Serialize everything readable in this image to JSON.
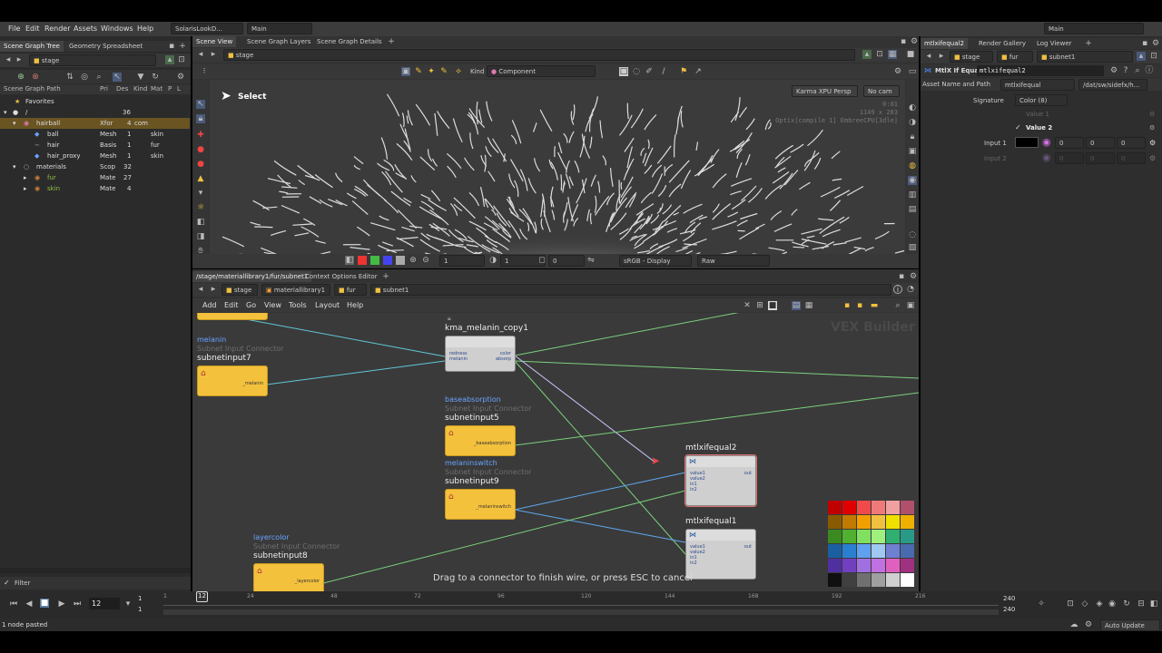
{
  "menubar": {
    "items": [
      "File",
      "Edit",
      "Render",
      "Assets",
      "Windows",
      "Help"
    ],
    "desktop": "SolarisLookD...",
    "desktop_right": "Main",
    "main_right": "Main"
  },
  "left": {
    "tabs": [
      "Scene Graph Tree",
      "Geometry Spreadsheet"
    ],
    "path": "stage",
    "columns": [
      "Scene Graph Path",
      "Pri",
      "Des",
      "Kind",
      "Mat",
      "P",
      "L"
    ],
    "rows": [
      {
        "name": "Favorites",
        "pri": "",
        "des": "",
        "kind": "",
        "mat": ""
      },
      {
        "name": "/",
        "pri": "",
        "des": "36",
        "kind": "",
        "mat": ""
      },
      {
        "name": "hairball",
        "pri": "Xfor",
        "des": "4",
        "kind": "com",
        "mat": ""
      },
      {
        "name": "ball",
        "pri": "Mesh",
        "des": "1",
        "kind": "",
        "mat": "skin"
      },
      {
        "name": "hair",
        "pri": "Basis",
        "des": "1",
        "kind": "",
        "mat": "fur"
      },
      {
        "name": "hair_proxy",
        "pri": "Mesh",
        "des": "1",
        "kind": "",
        "mat": "skin"
      },
      {
        "name": "materials",
        "pri": "Scop",
        "des": "32",
        "kind": "",
        "mat": ""
      },
      {
        "name": "fur",
        "pri": "Mate",
        "des": "27",
        "kind": "",
        "mat": ""
      },
      {
        "name": "skin",
        "pri": "Mate",
        "des": "4",
        "kind": "",
        "mat": ""
      }
    ],
    "filter": "Filter"
  },
  "viewer": {
    "tabs": [
      "Scene View",
      "Scene Graph Layers",
      "Scene Graph Details"
    ],
    "path": "stage",
    "kind_label": "Kind",
    "kind_value": "Component",
    "select": "Select",
    "renderer": "Karma XPU Persp",
    "cam": "No cam",
    "info": [
      "0:01",
      "1149 x 283",
      "Optix[compile 1] EmbreeCPU[3dle]"
    ],
    "bottom": {
      "val1": "1",
      "val2": "1",
      "val3": "0",
      "display": "sRGB - Display",
      "raw": "Raw"
    }
  },
  "network": {
    "tabs": [
      "/stage/materiallibrary1/fur/subnet1",
      "Context Options Editor"
    ],
    "crumbs": [
      "stage",
      "materiallibrary1",
      "fur",
      "subnet1"
    ],
    "menu": [
      "Add",
      "Edit",
      "Go",
      "View",
      "Tools",
      "Layout",
      "Help"
    ],
    "watermark": "VEX Builder",
    "hint": "Drag to a connector to finish wire, or press ESC to cancel",
    "nodes": {
      "melanin": {
        "title": "melanin",
        "sub": "Subnet Input Connector",
        "name": "subnetinput7",
        "port": "_melanin"
      },
      "kma": {
        "name": "kma_melanin_copy1",
        "in1": "redness",
        "in2": "melanin",
        "out1": "color",
        "out2": "absorp"
      },
      "base": {
        "title": "baseabsorption",
        "sub": "Subnet Input Connector",
        "name": "subnetinput5",
        "port": "_baseabsorption"
      },
      "mswitch": {
        "title": "melaninswitch",
        "sub": "Subnet Input Connector",
        "name": "subnetinput9",
        "port": "_melaninswitch"
      },
      "layer": {
        "title": "layercolor",
        "sub": "Subnet Input Connector",
        "name": "subnetinput8",
        "port": "_layercolor"
      },
      "if2": {
        "name": "mtlxifequal2",
        "ports": [
          "value1",
          "value2",
          "in1",
          "in2"
        ],
        "out": "out"
      },
      "if1": {
        "name": "mtlxifequal1",
        "ports": [
          "value1",
          "value2",
          "in1",
          "in2"
        ],
        "out": "out"
      }
    }
  },
  "params": {
    "tabs": [
      "mtlxifequal2",
      "Render Gallery",
      "Log Viewer"
    ],
    "crumbs": [
      "stage",
      "fur",
      "subnet1"
    ],
    "node_type": "MtlX If Equal",
    "node_name": "mtlxifequal2",
    "asset_label": "Asset Name and Path",
    "asset_value": "mtlxifequal",
    "asset_path": "/dat/sw/sidefx/h...",
    "signature_label": "Signature",
    "signature_value": "Color (8)",
    "value1": "Value 1",
    "value2": "Value 2",
    "input1_label": "Input 1",
    "input1_vals": [
      "0",
      "0",
      "0"
    ],
    "input2_label": "Input 2",
    "input2_vals": [
      "0",
      "0",
      "0"
    ]
  },
  "timeline": {
    "frame": "12",
    "start": "1",
    "start2": "1",
    "ticks": [
      "1",
      "24",
      "48",
      "72",
      "96",
      "120",
      "144",
      "168",
      "192",
      "216"
    ],
    "end": "240",
    "end2": "240",
    "marker": "12"
  },
  "status": {
    "message": "1 node pasted",
    "auto_update": "Auto Update"
  },
  "palette": [
    "#c00000",
    "#e00000",
    "#f04a4a",
    "#f07a7a",
    "#f0a0a0",
    "#b0506a",
    "#8a5a00",
    "#c07a00",
    "#f0a000",
    "#f0c040",
    "#f0e000",
    "#f0b000",
    "#3a8a20",
    "#50b030",
    "#80e060",
    "#a0f080",
    "#30b070",
    "#2a9a88",
    "#1a60a0",
    "#2a80d0",
    "#60a0f0",
    "#a0c8f0",
    "#7080d0",
    "#4a6ab0",
    "#5030a0",
    "#7040c0",
    "#a070e0",
    "#c070e0",
    "#e060c0",
    "#a03080",
    "#101010",
    "#404040",
    "#707070",
    "#a0a0a0",
    "#d0d0d0",
    "#ffffff"
  ]
}
